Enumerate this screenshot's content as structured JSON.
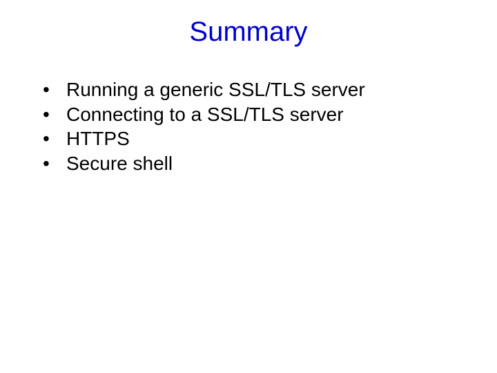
{
  "title": "Summary",
  "bullets": [
    {
      "text": "Running a generic SSL/TLS server"
    },
    {
      "text": "Connecting to a SSL/TLS server"
    },
    {
      "text": "HTTPS"
    },
    {
      "text": "Secure shell"
    }
  ]
}
